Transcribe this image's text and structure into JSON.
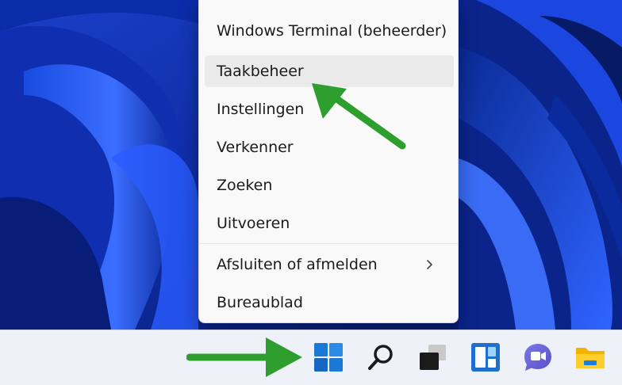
{
  "context_menu": {
    "items": [
      {
        "label": "Windows Terminal (beheerder)"
      },
      {
        "label": "Taakbeheer"
      },
      {
        "label": "Instellingen"
      },
      {
        "label": "Verkenner"
      },
      {
        "label": "Zoeken"
      },
      {
        "label": "Uitvoeren"
      },
      {
        "label": "Afsluiten of afmelden",
        "submenu_icon": "chevron-right-icon"
      },
      {
        "label": "Bureaublad"
      }
    ],
    "highlighted_item": "Taakbeheer"
  },
  "taskbar": {
    "icons": [
      "windows-start-icon",
      "search-icon",
      "task-view-icon",
      "widgets-icon",
      "teams-chat-icon",
      "file-explorer-icon"
    ]
  },
  "annotations": {
    "arrow_color": "#2e9e2e",
    "arrows": [
      "arrow-to-taakbeheer",
      "arrow-to-start-button"
    ]
  },
  "colors": {
    "wallpaper_base": "#0a1f6e",
    "wallpaper_accent": "#2a5cff",
    "menu_background": "#f9f9f9",
    "taskbar_background": "#eef1f7",
    "start_blue": "#1a78d6"
  }
}
